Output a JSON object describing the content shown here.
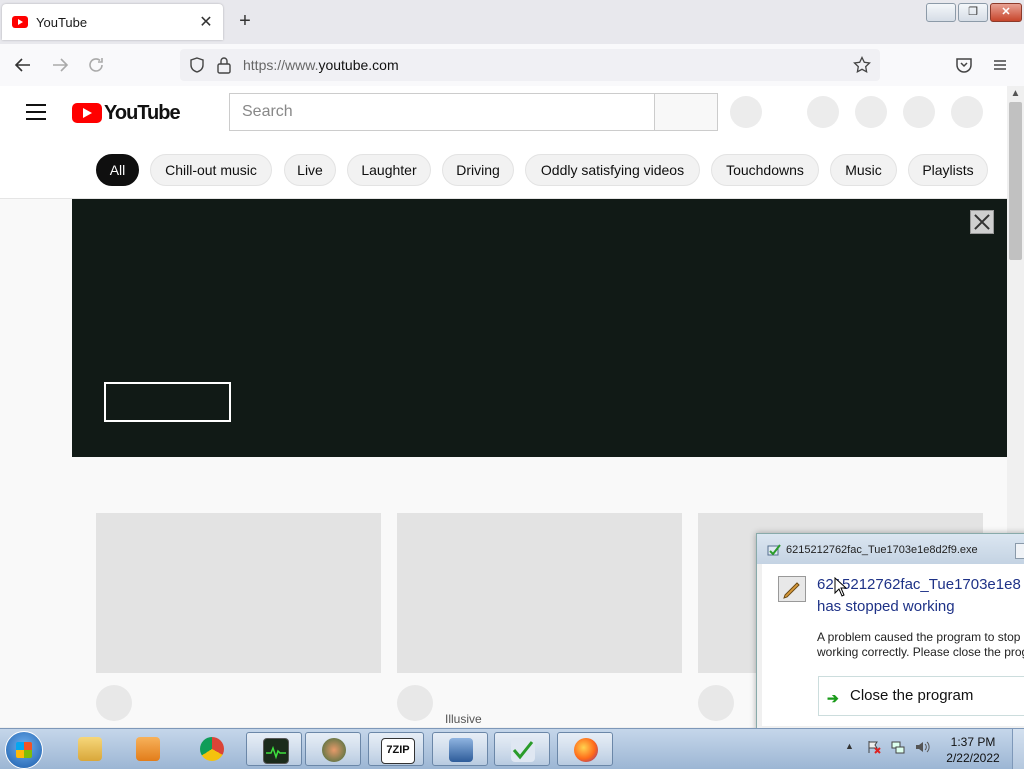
{
  "browser": {
    "tab_title": "YouTube",
    "tab_close": "✕",
    "new_tab": "+",
    "url_prefix": "https://www.",
    "url_domain": "youtube.com",
    "window_buttons": {
      "minimize": "▭",
      "restore": "❐",
      "close": "✕"
    }
  },
  "youtube": {
    "logo_text": "YouTube",
    "search_placeholder": "Search",
    "chips": [
      "All",
      "Chill-out music",
      "Live",
      "Laughter",
      "Driving",
      "Oddly satisfying videos",
      "Touchdowns",
      "Music",
      "Playlists"
    ],
    "active_chip": "All",
    "channel_label": "Illusive"
  },
  "dialog": {
    "title": "6215212762fac_Tue1703e1e8d2f9.exe",
    "heading_line1": "6215212762fac_Tue1703e1e8",
    "heading_line2": "has stopped working",
    "message": "A problem caused the program to stop working correctly. Please close the program.",
    "action_label": "Close the program",
    "action_arrow": "➔"
  },
  "taskbar": {
    "items": [
      "explorer-icon",
      "media-player-icon",
      "chrome-icon",
      "resource-monitor-icon",
      "app-icon",
      "7zip-icon",
      "network-tool-icon",
      "checkmark-tool-icon",
      "firefox-icon"
    ],
    "zip_label": "7ZIP",
    "time": "1:37 PM",
    "date": "2/22/2022",
    "tray_arrow": "▲"
  }
}
